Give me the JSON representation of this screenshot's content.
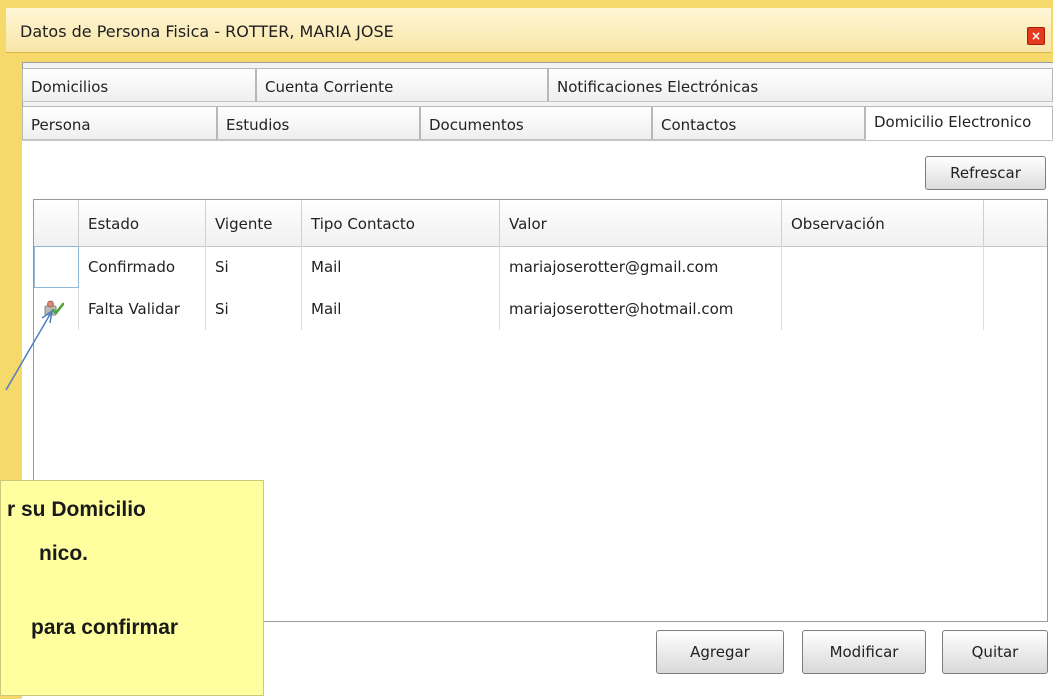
{
  "window": {
    "title": "Datos de Persona Fisica - ROTTER, MARIA JOSE",
    "close_label": "×"
  },
  "tabs_row1": [
    {
      "label": "Domicilios"
    },
    {
      "label": "Cuenta Corriente"
    },
    {
      "label": "Notificaciones Electrónicas"
    }
  ],
  "tabs_row2": [
    {
      "label": "Persona"
    },
    {
      "label": "Estudios"
    },
    {
      "label": "Documentos"
    },
    {
      "label": "Contactos"
    },
    {
      "label": "Domicilio Electronico",
      "active": true
    }
  ],
  "toolbar": {
    "refresh_label": "Refrescar"
  },
  "grid": {
    "columns": [
      "Estado",
      "Vigente",
      "Tipo Contacto",
      "Valor",
      "Observación"
    ],
    "rows": [
      {
        "estado": "Confirmado",
        "vigente": "Si",
        "tipo": "Mail",
        "valor": "mariajoserotter@gmail.com",
        "observacion": ""
      },
      {
        "estado": "Falta Validar",
        "vigente": "Si",
        "tipo": "Mail",
        "valor": "mariajoserotter@hotmail.com",
        "observacion": "",
        "icon": "validate-icon"
      }
    ]
  },
  "actions": {
    "add_label": "Agregar",
    "modify_label": "Modificar",
    "remove_label": "Quitar"
  },
  "callout": {
    "line1": "r su Domicilio",
    "line2": "nico.",
    "line3": "para confirmar"
  },
  "colors": {
    "window_border": "#f6d96b",
    "callout_bg": "#ffffa0",
    "close": "#e53a1f"
  }
}
